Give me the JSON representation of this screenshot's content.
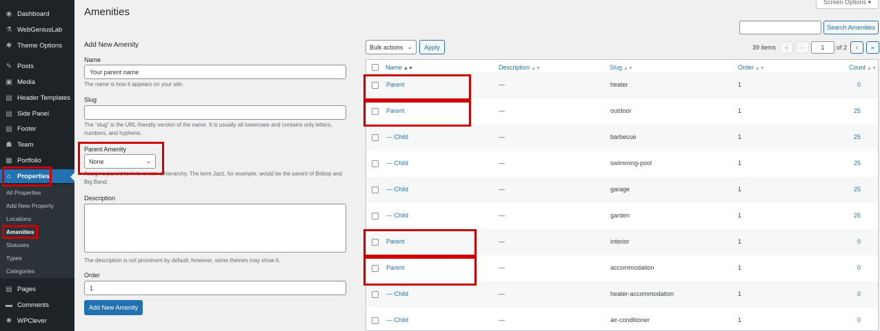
{
  "sidebar": {
    "items": [
      {
        "label": "Dashboard",
        "icon": "dashboard-icon",
        "glyph": "◉"
      },
      {
        "label": "WebGeniusLab",
        "icon": "flask-icon",
        "glyph": "⚗"
      },
      {
        "label": "Theme Options",
        "icon": "gear-icon",
        "glyph": "✱"
      },
      {
        "label": "Posts",
        "icon": "pin-icon",
        "glyph": "✎"
      },
      {
        "label": "Media",
        "icon": "media-icon",
        "glyph": "▣"
      },
      {
        "label": "Header Templates",
        "icon": "page-icon",
        "glyph": "▤"
      },
      {
        "label": "Side Panel",
        "icon": "page-icon",
        "glyph": "▤"
      },
      {
        "label": "Footer",
        "icon": "page-icon",
        "glyph": "▤"
      },
      {
        "label": "Team",
        "icon": "team-icon",
        "glyph": "☗"
      },
      {
        "label": "Portfolio",
        "icon": "portfolio-icon",
        "glyph": "▦"
      },
      {
        "label": "Properties",
        "icon": "home-icon",
        "glyph": "⌂"
      },
      {
        "label": "Pages",
        "icon": "page-icon",
        "glyph": "▤"
      },
      {
        "label": "Comments",
        "icon": "comment-icon",
        "glyph": "▬"
      },
      {
        "label": "WPClever",
        "icon": "sun-icon",
        "glyph": "✺"
      }
    ],
    "submenu": [
      "All Properties",
      "Add New Property",
      "Locations",
      "Amenities",
      "Statuses",
      "Types",
      "Categories"
    ]
  },
  "header": {
    "title": "Amenities",
    "screen_options": "Screen Options ▾"
  },
  "form": {
    "title": "Add New Amenity",
    "name_label": "Name",
    "name_value": "Your parent name",
    "name_desc": "The name is how it appears on your site.",
    "slug_label": "Slug",
    "slug_desc": "The “slug” is the URL-friendly version of the name. It is usually all lowercase and contains only letters, numbers, and hyphens.",
    "parent_label": "Parent Amenity",
    "parent_value": "None",
    "parent_desc": "Assign a parent term to create a hierarchy. The term Jazz, for example, would be the parent of Bebop and Big Band.",
    "desc_label": "Description",
    "desc_desc": "The description is not prominent by default; however, some themes may show it.",
    "order_label": "Order",
    "order_value": "1",
    "submit": "Add New Amenity"
  },
  "toolbar": {
    "bulk_actions": "Bulk actions",
    "apply": "Apply",
    "search_button": "Search Amenities",
    "items_count": "39 items",
    "first": "«",
    "prev": "‹",
    "current_page": "1",
    "of_pages": "of 2",
    "next": "›",
    "last": "»"
  },
  "table": {
    "columns": {
      "name": "Name",
      "description": "Description",
      "slug": "Slug",
      "order": "Order",
      "count": "Count"
    },
    "rows": [
      {
        "name": "Parent",
        "description": "—",
        "slug": "heater",
        "order": "1",
        "count": "0"
      },
      {
        "name": "Parent",
        "description": "—",
        "slug": "outdoor",
        "order": "1",
        "count": "25"
      },
      {
        "name": "— Child",
        "description": "—",
        "slug": "barbecue",
        "order": "1",
        "count": "25"
      },
      {
        "name": "— Child",
        "description": "—",
        "slug": "swimming-pool",
        "order": "1",
        "count": "25"
      },
      {
        "name": "— Child",
        "description": "—",
        "slug": "garage",
        "order": "1",
        "count": "25"
      },
      {
        "name": "— Child",
        "description": "—",
        "slug": "garden",
        "order": "1",
        "count": "25"
      },
      {
        "name": "Parent",
        "description": "—",
        "slug": "interior",
        "order": "1",
        "count": "0"
      },
      {
        "name": "Parent",
        "description": "—",
        "slug": "accommodation",
        "order": "1",
        "count": "0"
      },
      {
        "name": "— Child",
        "description": "—",
        "slug": "heater-accommodation",
        "order": "1",
        "count": "0"
      },
      {
        "name": "— Child",
        "description": "—",
        "slug": "air-conditioner",
        "order": "1",
        "count": "0"
      }
    ]
  },
  "colors": {
    "accent": "#2271b1",
    "highlight": "#d10000",
    "sidebar": "#1d2327"
  }
}
